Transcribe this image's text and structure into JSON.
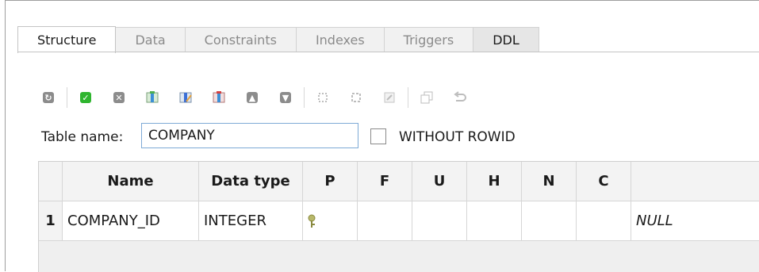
{
  "tabs": [
    {
      "label": "Structure",
      "active": true
    },
    {
      "label": "Data"
    },
    {
      "label": "Constraints"
    },
    {
      "label": "Indexes"
    },
    {
      "label": "Triggers"
    },
    {
      "label": "DDL"
    }
  ],
  "toolbar": {
    "icons": [
      "refresh-icon",
      "commit-icon",
      "rollback-icon",
      "add-column-icon",
      "edit-column-icon",
      "delete-column-icon",
      "move-up-icon",
      "move-down-icon",
      "add-constraint-icon",
      "edit-constraint-icon",
      "delete-constraint-icon",
      "copy-icon",
      "undo-icon"
    ]
  },
  "form": {
    "table_name_label": "Table name:",
    "table_name_value": "COMPANY",
    "without_rowid_label": "WITHOUT ROWID",
    "without_rowid_checked": false
  },
  "grid": {
    "headers": [
      "Name",
      "Data type",
      "P",
      "F",
      "U",
      "H",
      "N",
      "C",
      ""
    ],
    "rows": [
      {
        "num": "1",
        "name": "COMPANY_ID",
        "type": "INTEGER",
        "pk": true,
        "default": "NULL"
      }
    ]
  },
  "colors": {
    "accent": "#7eaad6",
    "check_green": "#2fb52f"
  }
}
